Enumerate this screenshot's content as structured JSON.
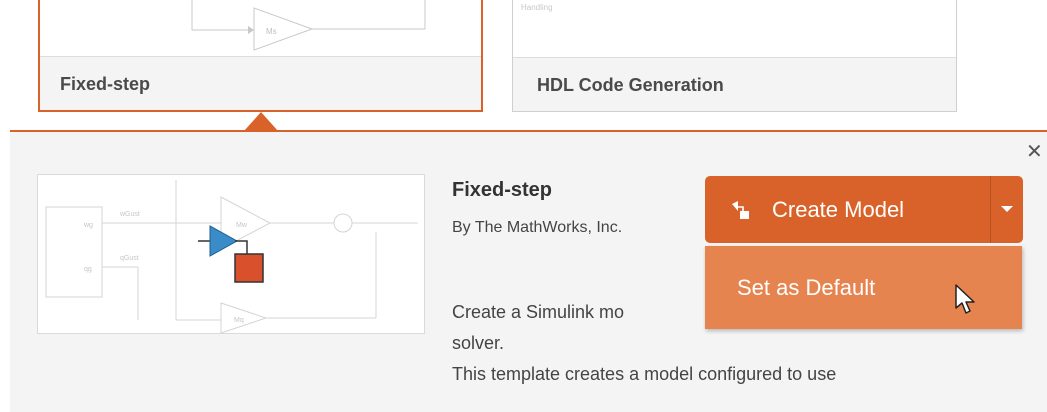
{
  "templates": [
    {
      "label": "Fixed-step",
      "selected": true
    },
    {
      "label": "HDL Code Generation",
      "selected": false
    }
  ],
  "detail": {
    "title": "Fixed-step",
    "author": "By The MathWorks, Inc.",
    "description": "Create a Simulink model configured to use a fixed-step solver.",
    "description_lines": [
      "Create a Simulink mo",
      "solver.",
      "This template creates a model configured to use"
    ]
  },
  "actions": {
    "create_label": "Create Model",
    "menu_items": [
      "Set as Default"
    ]
  },
  "diagram_labels": {
    "hdl_snippet": "Handling",
    "thumb_gain": "Ms",
    "preview": [
      "wGust",
      "qGust",
      "wg",
      "qg",
      "Mw",
      "Mq"
    ]
  },
  "icons": {
    "close": "close-icon",
    "create": "new-model-icon",
    "dropdown": "caret-down-icon",
    "cursor": "mouse-pointer-icon"
  },
  "colors": {
    "accent": "#d9622b",
    "menu_bg": "#e6844f",
    "panel_bg": "#f4f4f4"
  }
}
